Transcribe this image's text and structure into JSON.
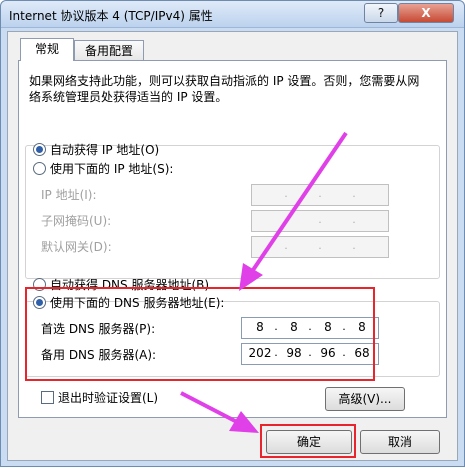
{
  "title": "Internet 协议版本 4 (TCP/IPv4) 属性",
  "titlebar": {
    "help_label": "?",
    "close_label": "X"
  },
  "tabs": [
    "常规",
    "备用配置"
  ],
  "description": "如果网络支持此功能，则可以获取自动指派的 IP 设置。否则，您需要从网络系统管理员处获得适当的 IP 设置。",
  "ip": {
    "auto_label": "自动获得 IP 地址(O)",
    "manual_label": "使用下面的 IP 地址(S):",
    "fields": [
      {
        "label": "IP 地址(I):"
      },
      {
        "label": "子网掩码(U):"
      },
      {
        "label": "默认网关(D):"
      }
    ]
  },
  "dns": {
    "auto_label": "自动获得 DNS 服务器地址(B)",
    "manual_label": "使用下面的 DNS 服务器地址(E):",
    "preferred": {
      "label": "首选 DNS 服务器(P):",
      "octets": [
        "8",
        "8",
        "8",
        "8"
      ]
    },
    "alternate": {
      "label": "备用 DNS 服务器(A):",
      "octets": [
        "202",
        "98",
        "96",
        "68"
      ]
    }
  },
  "validate_label": "退出时验证设置(L)",
  "advanced_label": "高级(V)...",
  "ok_label": "确定",
  "cancel_label": "取消",
  "colors": {
    "highlight": "#e8242c",
    "arrow": "#e040e8"
  }
}
